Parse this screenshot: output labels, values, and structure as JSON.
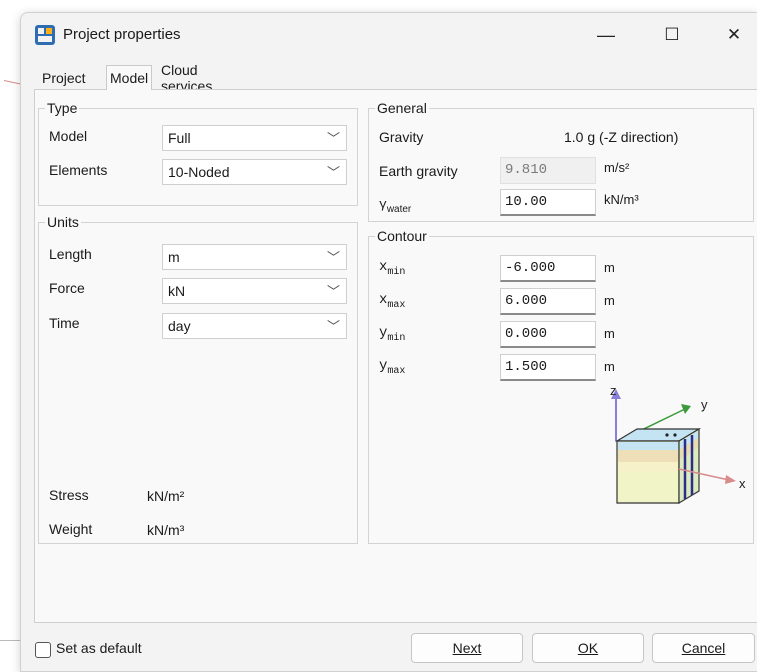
{
  "window": {
    "title": "Project properties",
    "min_glyph": "—",
    "max_glyph": "☐",
    "close_glyph": "✕"
  },
  "tabs": [
    "Project",
    "Model",
    "Cloud services"
  ],
  "type_group": {
    "label": "Type",
    "model_label": "Model",
    "model_value": "Full",
    "elements_label": "Elements",
    "elements_value": "10-Noded"
  },
  "units_group": {
    "label": "Units",
    "length_label": "Length",
    "length_value": "m",
    "force_label": "Force",
    "force_value": "kN",
    "time_label": "Time",
    "time_value": "day",
    "stress_label": "Stress",
    "stress_value": "kN/m²",
    "weight_label": "Weight",
    "weight_value": "kN/m³"
  },
  "general_group": {
    "label": "General",
    "gravity_label": "Gravity",
    "gravity_value": "1.0 g (-Z direction)",
    "earth_gravity_label": "Earth gravity",
    "earth_gravity_value": "9.810",
    "earth_gravity_unit": "m/s²",
    "gamma_symbol": "γ",
    "gamma_sub": "water",
    "gamma_value": "10.00",
    "gamma_unit": "kN/m³"
  },
  "contour_group": {
    "label": "Contour",
    "rows": [
      {
        "sym": "x",
        "sub": "min",
        "value": "-6.000",
        "unit": "m"
      },
      {
        "sym": "x",
        "sub": "max",
        "value": "6.000",
        "unit": "m"
      },
      {
        "sym": "y",
        "sub": "min",
        "value": "0.000",
        "unit": "m"
      },
      {
        "sym": "y",
        "sub": "max",
        "value": "1.500",
        "unit": "m"
      }
    ],
    "axes": {
      "z": "z",
      "y": "y",
      "x": "x"
    }
  },
  "footer": {
    "default_checkbox": "Set as default",
    "next": "Next",
    "ok": "OK",
    "cancel": "Cancel"
  }
}
